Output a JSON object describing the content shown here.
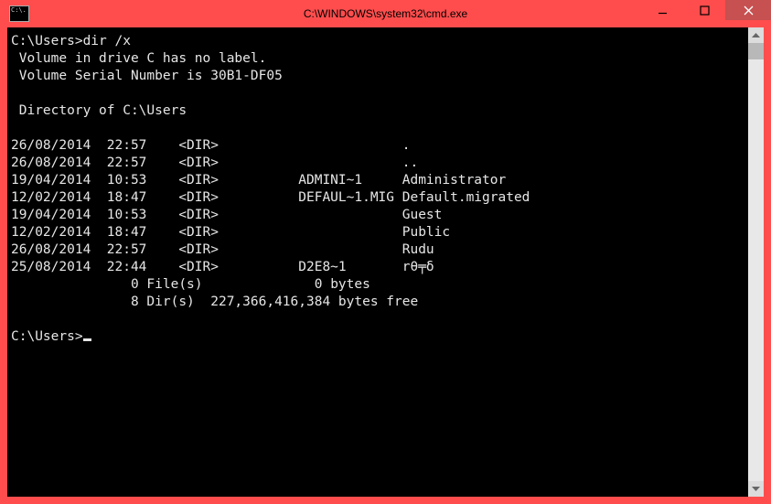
{
  "window": {
    "title": "C:\\WINDOWS\\system32\\cmd.exe",
    "icon_text": "C:\\."
  },
  "console": {
    "prompt1": "C:\\Users>",
    "command1": "dir /x",
    "vol_line1": " Volume in drive C has no label.",
    "vol_line2": " Volume Serial Number is 30B1-DF05",
    "dir_of": " Directory of C:\\Users",
    "rows": [
      {
        "date": "26/08/2014",
        "time": "22:57",
        "type": "<DIR>",
        "short": "",
        "name": "."
      },
      {
        "date": "26/08/2014",
        "time": "22:57",
        "type": "<DIR>",
        "short": "",
        "name": ".."
      },
      {
        "date": "19/04/2014",
        "time": "10:53",
        "type": "<DIR>",
        "short": "ADMINI~1",
        "name": "Administrator"
      },
      {
        "date": "12/02/2014",
        "time": "18:47",
        "type": "<DIR>",
        "short": "DEFAUL~1.MIG",
        "name": "Default.migrated"
      },
      {
        "date": "19/04/2014",
        "time": "10:53",
        "type": "<DIR>",
        "short": "",
        "name": "Guest"
      },
      {
        "date": "12/02/2014",
        "time": "18:47",
        "type": "<DIR>",
        "short": "",
        "name": "Public"
      },
      {
        "date": "26/08/2014",
        "time": "22:57",
        "type": "<DIR>",
        "short": "",
        "name": "Rudu"
      },
      {
        "date": "25/08/2014",
        "time": "22:44",
        "type": "<DIR>",
        "short": "D2E8~1",
        "name": "rθ╤δ"
      }
    ],
    "summary1": "               0 File(s)              0 bytes",
    "summary2": "               8 Dir(s)  227,366,416,384 bytes free",
    "prompt2": "C:\\Users>"
  }
}
